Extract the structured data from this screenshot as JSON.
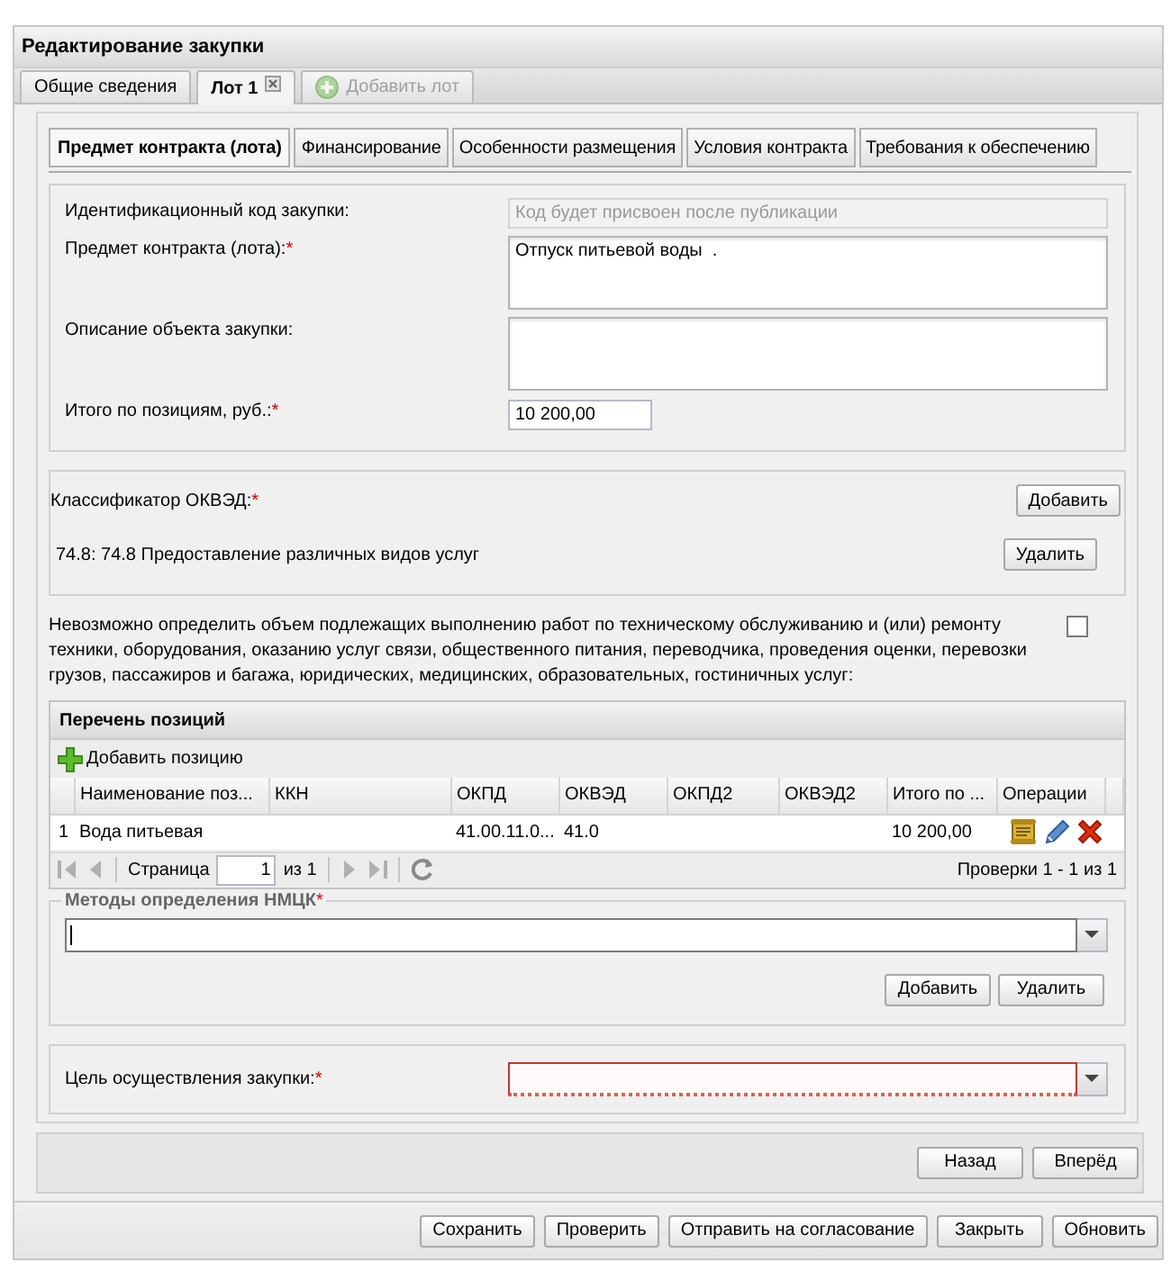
{
  "window": {
    "title": "Редактирование закупки"
  },
  "required_mark": "*",
  "tabs": [
    {
      "label": "Общие сведения",
      "selected": false,
      "disabled": false,
      "kind": "plain"
    },
    {
      "label": "Лот 1",
      "selected": true,
      "disabled": false,
      "kind": "closable"
    },
    {
      "label": "Добавить лот",
      "selected": false,
      "disabled": true,
      "kind": "add"
    }
  ],
  "subtabs": [
    {
      "label": "Предмет контракта (лота)",
      "selected": true
    },
    {
      "label": "Финансирование",
      "selected": false
    },
    {
      "label": "Особенности размещения",
      "selected": false
    },
    {
      "label": "Условия контракта",
      "selected": false
    },
    {
      "label": "Требования к обеспечению",
      "selected": false
    }
  ],
  "fields": [
    {
      "label": "Идентификационный код закупки:",
      "required": false,
      "kind": "text",
      "disabled": true,
      "placeholder": "Код будет присвоен после публикации"
    },
    {
      "label": "Предмет контракта (лота):",
      "required": true,
      "kind": "textarea",
      "disabled": false,
      "value": "Отпуск питьевой воды  ."
    },
    {
      "label": "Описание объекта закупки:",
      "required": false,
      "kind": "textarea",
      "disabled": false
    },
    {
      "label": "Итого по позициям, руб.:",
      "required": true,
      "kind": "short",
      "disabled": false,
      "value": "10 200,00"
    }
  ],
  "okved": {
    "label": "Классификатор ОКВЭД:",
    "required": true,
    "add_button": "Добавить",
    "items": [
      {
        "text": "74.8: 74.8 Предоставление различных видов услуг",
        "delete_button": "Удалить"
      }
    ]
  },
  "undeterminable": {
    "text": "Невозможно определить объем подлежащих выполнению работ по техническому обслуживанию и (или) ремонту техники, оборудования, оказанию услуг связи, общественного питания, переводчика, проведения оценки, перевозки грузов, пассажиров и багажа, юридических, медицинских, образовательных, гостиничных услуг:",
    "checked": false
  },
  "positions": {
    "title": "Перечень позиций",
    "add_button": "Добавить позицию",
    "columns": [
      "Наименование поз...",
      "ККН",
      "ОКПД",
      "ОКВЭД",
      "ОКПД2",
      "ОКВЭД2",
      "Итого по ...",
      "Операции"
    ],
    "rows": [
      {
        "number": "1",
        "name": "Вода питьевая",
        "okpd": "41.00.11.0...",
        "okved": "41.0",
        "total": "10 200,00"
      }
    ],
    "pager": {
      "page_label": "Страница",
      "page": "1",
      "of": "из 1",
      "summary": "Проверки 1 - 1 из 1"
    }
  },
  "nmck": {
    "legend": "Методы определения НМЦК",
    "required": true,
    "focused": true,
    "buttons": [
      "Добавить",
      "Удалить"
    ]
  },
  "purpose": {
    "label": "Цель осуществления закупки:",
    "required": true,
    "invalid": true
  },
  "nav_buttons": [
    "Назад",
    "Вперёд"
  ],
  "footer_buttons": [
    "Сохранить",
    "Проверить",
    "Отправить на согласование",
    "Закрыть",
    "Обновить"
  ]
}
